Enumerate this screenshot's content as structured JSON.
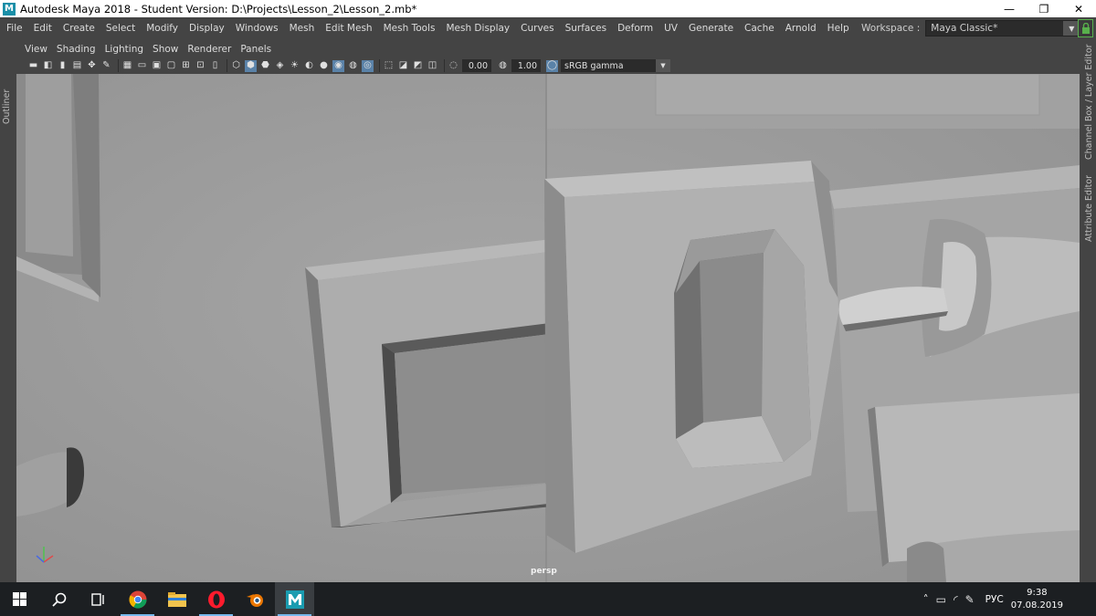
{
  "window": {
    "title": "Autodesk Maya 2018 - Student Version: D:\\Projects\\Lesson_2\\Lesson_2.mb*",
    "logo_letter": "M",
    "minimize": "—",
    "restore": "❐",
    "close": "✕"
  },
  "menubar": {
    "items": [
      "File",
      "Edit",
      "Create",
      "Select",
      "Modify",
      "Display",
      "Windows",
      "Mesh",
      "Edit Mesh",
      "Mesh Tools",
      "Mesh Display",
      "Curves",
      "Surfaces",
      "Deform",
      "UV",
      "Generate",
      "Cache",
      "Arnold",
      "Help"
    ],
    "workspace_label": "Workspace :",
    "workspace_value": "Maya Classic*"
  },
  "side_tabs": {
    "outliner": "Outliner",
    "channel_box": "Channel Box / Layer Editor",
    "attribute_editor": "Attribute Editor"
  },
  "panel": {
    "menu": [
      "View",
      "Shading",
      "Lighting",
      "Show",
      "Renderer",
      "Panels"
    ],
    "exposure": "0.00",
    "gamma": "1.00",
    "color_space": "sRGB gamma",
    "camera_label": "persp"
  },
  "taskbar": {
    "tray_language": "РУС",
    "time": "9:38",
    "date": "07.08.2019"
  },
  "colors": {
    "accent": "#5a82a8",
    "viewport_bg": "#9c9c9c",
    "taskbar_bg": "#1c1f22",
    "lock_green": "#58b04c"
  },
  "icons": {
    "start": "windows-start-icon",
    "search": "search-icon",
    "task_view": "task-view-icon",
    "chrome": "chrome-icon",
    "explorer": "file-explorer-icon",
    "opera": "opera-icon",
    "blender": "blender-icon",
    "maya": "maya-icon"
  }
}
